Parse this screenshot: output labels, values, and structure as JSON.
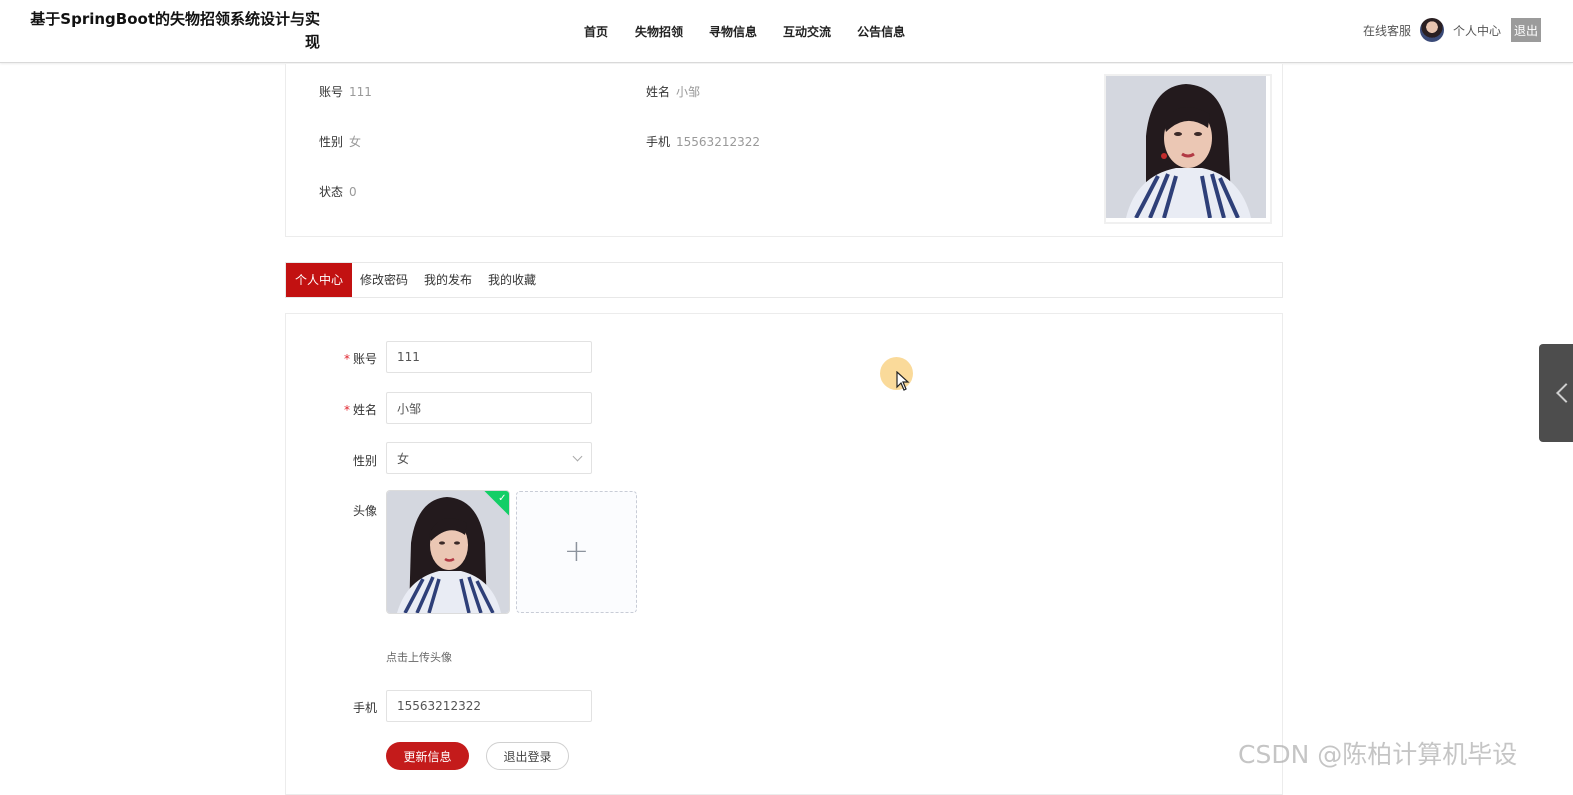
{
  "header": {
    "site_title": "基于SpringBoot的失物招领系统设计与实现",
    "nav": [
      "首页",
      "失物招领",
      "寻物信息",
      "互动交流",
      "公告信息"
    ],
    "online_service": "在线客服",
    "personal_center": "个人中心",
    "logout": "退出"
  },
  "profile": {
    "account_label": "账号",
    "account_value": "111",
    "name_label": "姓名",
    "name_value": "小邹",
    "gender_label": "性别",
    "gender_value": "女",
    "phone_label": "手机",
    "phone_value": "15563212322",
    "status_label": "状态",
    "status_value": "0"
  },
  "tabs": [
    "个人中心",
    "修改密码",
    "我的发布",
    "我的收藏"
  ],
  "form": {
    "account_label": "账号",
    "account_value": "111",
    "name_label": "姓名",
    "name_value": "小邹",
    "gender_label": "性别",
    "gender_value": "女",
    "avatar_label": "头像",
    "upload_tip": "点击上传头像",
    "phone_label": "手机",
    "phone_value": "15563212322",
    "update_button": "更新信息",
    "logout_button": "退出登录"
  },
  "icons": {
    "upload_success": "check-icon",
    "upload_add": "plus-icon",
    "drawer_toggle": "chevron-left-icon"
  },
  "colors": {
    "accent": "#c21111",
    "upload_success": "#13ce66"
  },
  "watermark": "CSDN @陈柏计算机毕设"
}
